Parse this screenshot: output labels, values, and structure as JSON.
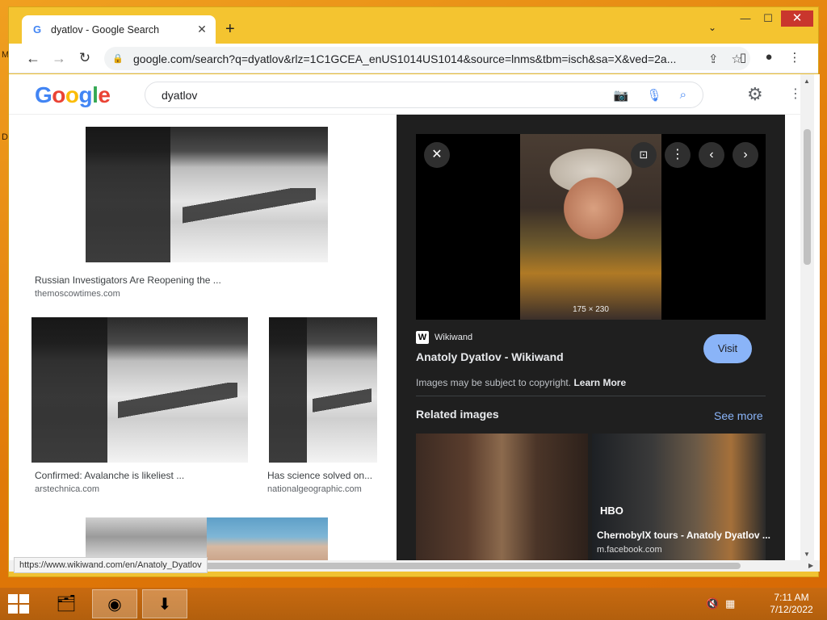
{
  "browser": {
    "tab_title": "dyatlov - Google Search",
    "tab_favicon": "G",
    "url": "google.com/search?q=dyatlov&rlz=1C1GCEA_enUS1014US1014&source=lnms&tbm=isch&sa=X&ved=2a...",
    "status_url": "https://www.wikiwand.com/en/Anatoly_Dyatlov"
  },
  "google": {
    "logo_letters": [
      "G",
      "o",
      "o",
      "g",
      "l",
      "e"
    ],
    "query": "dyatlov"
  },
  "results": [
    {
      "title": "Russian Investigators Are Reopening the ...",
      "source": "themoscowtimes.com"
    },
    {
      "title": "Confirmed: Avalanche is likeliest ...",
      "source": "arstechnica.com"
    },
    {
      "title": "Has science solved on...",
      "source": "nationalgeographic.com"
    }
  ],
  "panel": {
    "dimensions": "175 × 230",
    "site_icon": "W",
    "site": "Wikiwand",
    "title": "Anatoly Dyatlov - Wikiwand",
    "visit_label": "Visit",
    "copyright_text": "Images may be subject to copyright.",
    "learn_more": "Learn More",
    "related_heading": "Related images",
    "see_more": "See more",
    "related": [
      {
        "caption": "",
        "source": ""
      },
      {
        "badge": "HBO",
        "caption": "ChernobylX tours - Anatoly Dyatlov ...",
        "source": "m.facebook.com"
      }
    ]
  },
  "taskbar": {
    "time": "7:11 AM",
    "date": "7/12/2022"
  },
  "colors": {
    "accent_blue": "#8ab4f8",
    "panel_bg": "#1f1f1f",
    "desktop": "#e88a10",
    "close_red": "#c9362d"
  }
}
